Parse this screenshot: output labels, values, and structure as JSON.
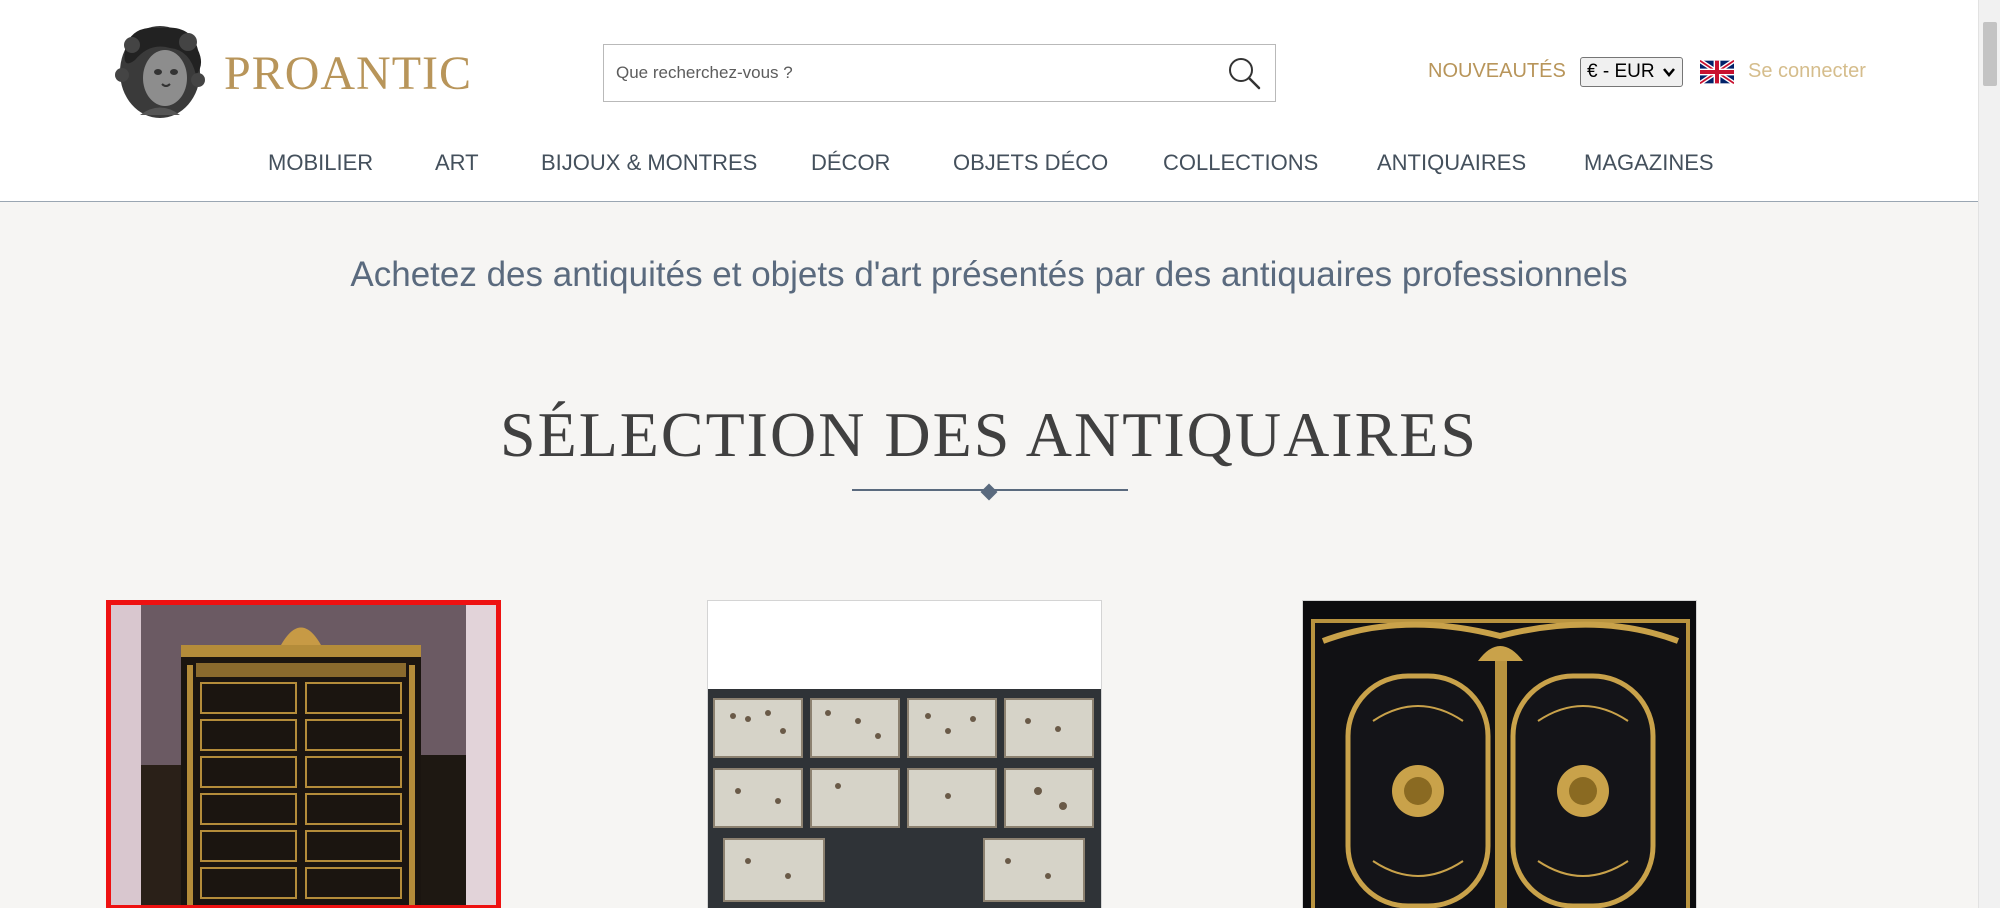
{
  "header": {
    "logo_text": "PROANTIC",
    "search_placeholder": "Que recherchez-vous ?",
    "nouveautes_label": "NOUVEAUTÉS",
    "currency_value": "€ - EUR",
    "login_label": "Se connecter"
  },
  "nav": {
    "items": [
      "MOBILIER",
      "ART",
      "BIJOUX & MONTRES",
      "DÉCOR",
      "OBJETS DÉCO",
      "COLLECTIONS",
      "ANTIQUAIRES",
      "MAGAZINES"
    ]
  },
  "main": {
    "tagline": "Achetez des antiquités et objets d'art présentés par des antiquaires professionnels",
    "section_title": "SÉLECTION DES ANTIQUAIRES"
  },
  "icons": {
    "search": "search-icon",
    "flag": "uk-flag-icon",
    "logo": "bust-logo-icon"
  },
  "colors": {
    "brand_gold": "#b8955a",
    "nav_text": "#44505c",
    "tagline": "#5a6a7e",
    "selection_border": "#ee1111"
  }
}
